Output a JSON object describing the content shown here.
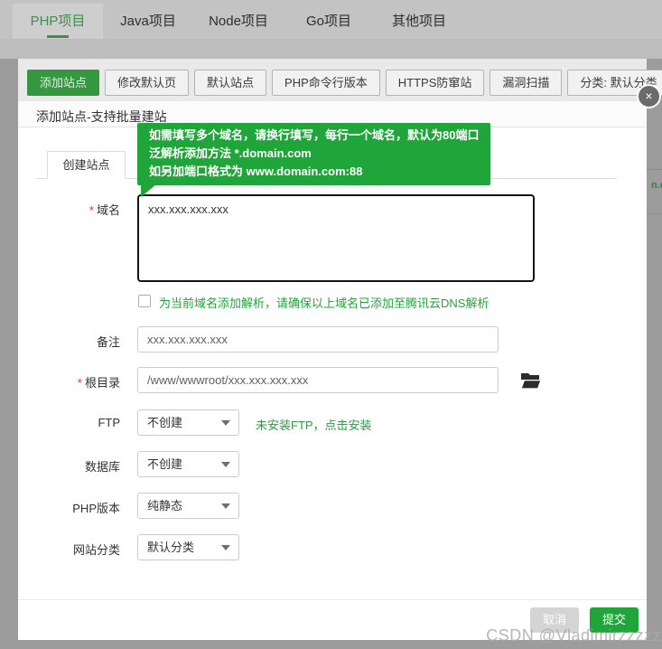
{
  "colors": {
    "accent_green": "#20a53a",
    "dim_backdrop": "#9c9c9c"
  },
  "top_tabs": [
    {
      "label": "PHP项目",
      "active": true
    },
    {
      "label": "Java项目",
      "active": false
    },
    {
      "label": "Node项目",
      "active": false
    },
    {
      "label": "Go项目",
      "active": false
    },
    {
      "label": "其他项目",
      "active": false
    }
  ],
  "toolbar": {
    "add_site": "添加站点",
    "buttons": [
      "修改默认页",
      "默认站点",
      "PHP命令行版本",
      "HTTPS防窜站",
      "漏洞扫描"
    ],
    "category_filter": "分类: 默认分类"
  },
  "background_fragment": "n.c",
  "modal": {
    "title": "添加站点-支持批量建站",
    "close": "×",
    "tooltip_lines": [
      "如需填写多个域名，请换行填写，每行一个域名，默认为80端口",
      "泛解析添加方法 *.domain.com",
      "如另加端口格式为 www.domain.com:88"
    ],
    "tab": "创建站点",
    "required_mark": "*",
    "form": {
      "domain_label": "域名",
      "domain_value": "xxx.xxx.xxx.xxx",
      "dns_checkbox_label": "为当前域名添加解析，请确保以上域名已添加至腾讯云DNS解析",
      "dns_checkbox_checked": false,
      "note_label": "备注",
      "note_value": "xxx.xxx.xxx.xxx",
      "root_label": "根目录",
      "root_value": "/www/wwwroot/xxx.xxx.xxx.xxx",
      "ftp_label": "FTP",
      "ftp_value": "不创建",
      "ftp_hint": "未安装FTP，点击安装",
      "db_label": "数据库",
      "db_value": "不创建",
      "php_label": "PHP版本",
      "php_value": "纯静态",
      "site_category_label": "网站分类",
      "site_category_value": "默认分类"
    },
    "footer": {
      "cancel": "取消",
      "submit": "提交"
    }
  },
  "watermark": "CSDN @Vladimirzzzzz"
}
